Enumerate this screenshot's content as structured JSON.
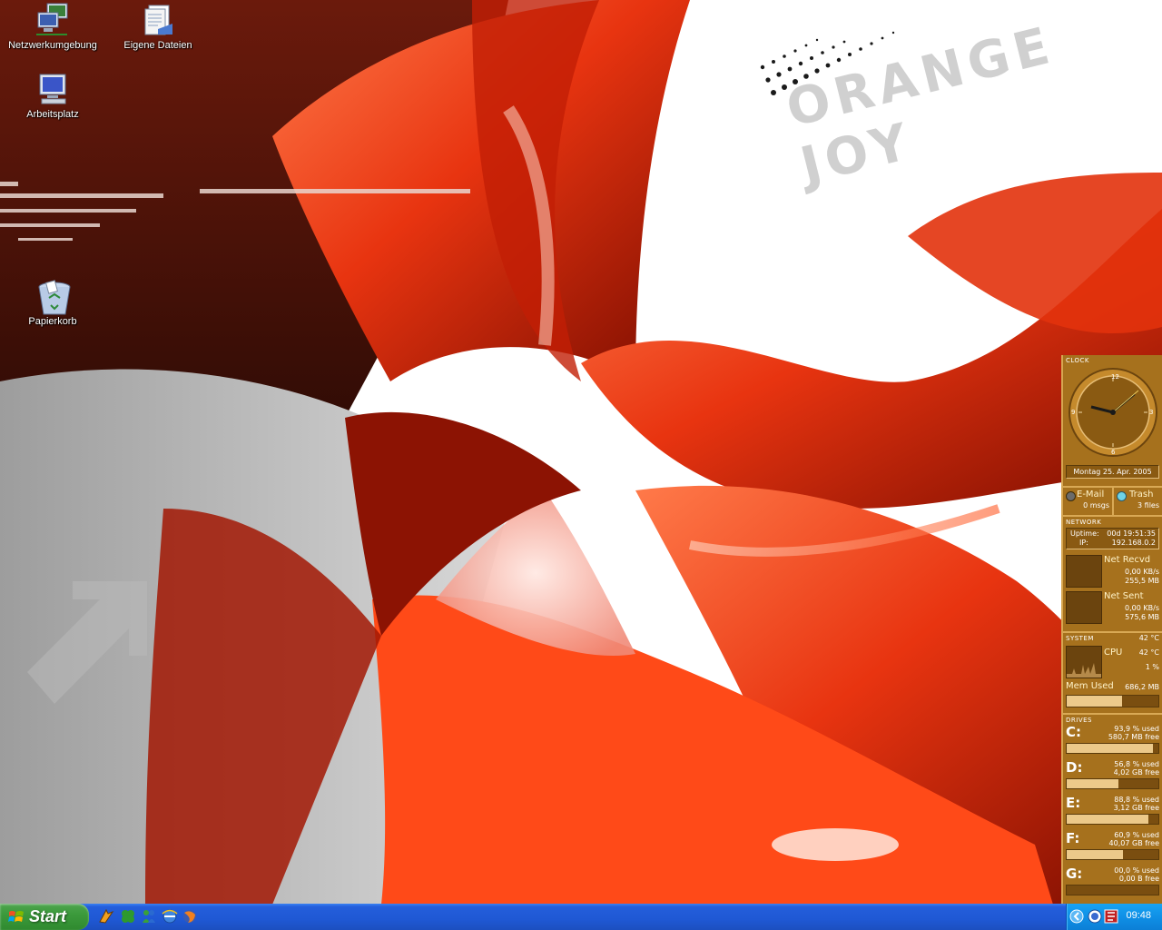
{
  "desktop": {
    "icons": [
      {
        "label": "Netzwerkumgebung",
        "icon": "network-places-icon"
      },
      {
        "label": "Eigene Dateien",
        "icon": "my-documents-icon"
      },
      {
        "label": "Arbeitsplatz",
        "icon": "my-computer-icon"
      },
      {
        "label": "Papierkorb",
        "icon": "recycle-bin-icon"
      }
    ],
    "wallpaper_text": "ORANGE JOY",
    "colors": {
      "wallpaper_red": "#e8340e",
      "wallpaper_white": "#ffffff"
    }
  },
  "panel": {
    "clock": {
      "title": "CLOCK",
      "marks": [
        "12",
        "3",
        "6",
        "9"
      ],
      "date": "Montag 25. Apr. 2005"
    },
    "mail": {
      "label": "E-Mail",
      "value": "0 msgs"
    },
    "trash": {
      "label": "Trash",
      "value": "3 files"
    },
    "network": {
      "title": "NETWORK",
      "uptime_label": "Uptime:",
      "uptime_value": "00d 19:51:35",
      "ip_label": "IP:",
      "ip_value": "192.168.0.2",
      "recvd_label": "Net Recvd",
      "recvd_rate": "0,00 KB/s",
      "recvd_total": "255,5 MB",
      "sent_label": "Net Sent",
      "sent_rate": "0,00 KB/s",
      "sent_total": "575,6 MB"
    },
    "system": {
      "title": "SYSTEM",
      "temp": "42 °C",
      "cpu_label": "CPU",
      "cpu_temp": "42 °C",
      "cpu_load": "1 %",
      "mem_label": "Mem Used",
      "mem_value": "686,2 MB",
      "mem_fraction": 0.6
    },
    "drives": {
      "title": "DRIVES",
      "list": [
        {
          "letter": "C:",
          "used": "93,9 % used",
          "free": "580,7 MB free",
          "fraction": 0.939
        },
        {
          "letter": "D:",
          "used": "56,8 % used",
          "free": "4,02 GB free",
          "fraction": 0.568
        },
        {
          "letter": "E:",
          "used": "88,8 % used",
          "free": "3,12 GB free",
          "fraction": 0.888
        },
        {
          "letter": "F:",
          "used": "60,9 % used",
          "free": "40,07 GB free",
          "fraction": 0.609
        },
        {
          "letter": "G:",
          "used": "00,0 % used",
          "free": "0,00 B free",
          "fraction": 0.0
        }
      ]
    }
  },
  "taskbar": {
    "start_label": "Start",
    "quick_launch": [
      "winamp-icon",
      "clover-icon",
      "messenger-icon",
      "ie-icon",
      "firefox-icon"
    ],
    "tray_icons": [
      "chevron-left-icon",
      "network-tray-icon",
      "samurize-tray-icon"
    ],
    "clock": "09:48",
    "colors": {
      "taskbar_blue": "#245edb",
      "start_green": "#3c9a3c",
      "tray_blue": "#0f90e6"
    }
  }
}
